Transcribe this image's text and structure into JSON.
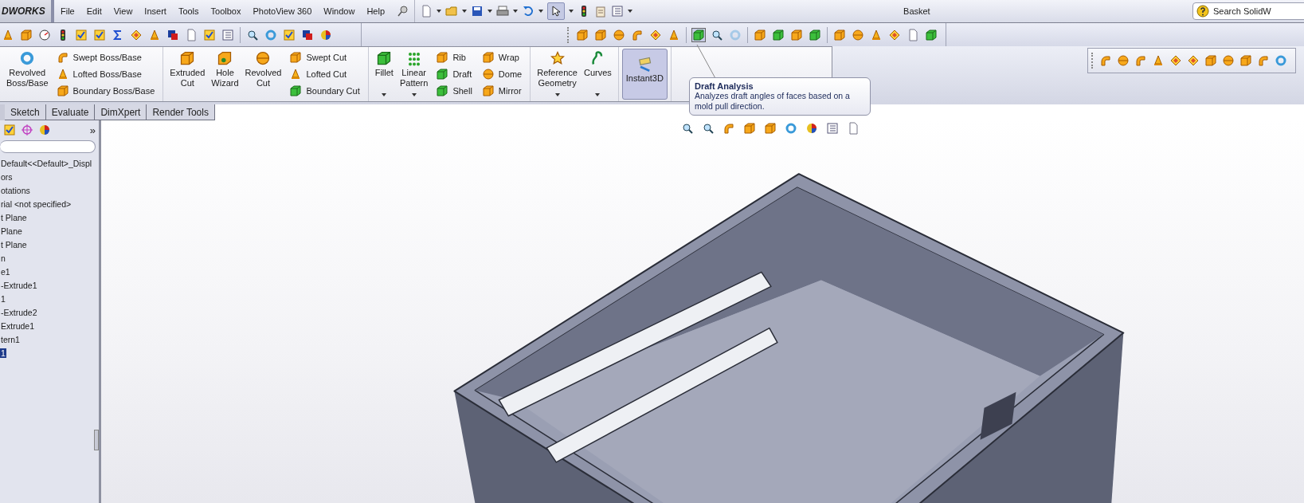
{
  "title_bar": {
    "logo": "DWORKS",
    "menu": [
      "File",
      "Edit",
      "View",
      "Insert",
      "Tools",
      "Toolbox",
      "PhotoView 360",
      "Window",
      "Help"
    ],
    "document_title": "Basket",
    "search": {
      "placeholder": "Search SolidW"
    }
  },
  "command_manager": {
    "groups": [
      {
        "items": [
          {
            "kind": "large",
            "label": "Revolved Boss/Base",
            "dropdown": false,
            "on": false
          },
          {
            "kind": "small",
            "label": "Swept Boss/Base"
          },
          {
            "kind": "small",
            "label": "Lofted Boss/Base"
          },
          {
            "kind": "small",
            "label": "Boundary Boss/Base"
          }
        ]
      },
      {
        "items": [
          {
            "kind": "large",
            "label": "Extruded Cut",
            "dropdown": false,
            "on": false
          },
          {
            "kind": "large",
            "label": "Hole Wizard",
            "dropdown": false,
            "on": false
          },
          {
            "kind": "large",
            "label": "Revolved Cut",
            "dropdown": false,
            "on": false
          },
          {
            "kind": "small",
            "label": "Swept Cut"
          },
          {
            "kind": "small",
            "label": "Lofted Cut"
          },
          {
            "kind": "small",
            "label": "Boundary Cut"
          }
        ]
      },
      {
        "items": [
          {
            "kind": "large",
            "label": "Fillet",
            "dropdown": true,
            "on": false
          },
          {
            "kind": "large",
            "label": "Linear Pattern",
            "dropdown": true,
            "on": false
          },
          {
            "kind": "small",
            "label": "Rib"
          },
          {
            "kind": "small",
            "label": "Draft"
          },
          {
            "kind": "small",
            "label": "Shell"
          },
          {
            "kind": "small",
            "label": "Wrap"
          },
          {
            "kind": "small",
            "label": "Dome"
          },
          {
            "kind": "small",
            "label": "Mirror"
          }
        ]
      },
      {
        "items": [
          {
            "kind": "large",
            "label": "Reference Geometry",
            "dropdown": true,
            "on": false
          },
          {
            "kind": "large",
            "label": "Curves",
            "dropdown": true,
            "on": false
          }
        ]
      },
      {
        "items": [
          {
            "kind": "large",
            "label": "Instant3D",
            "dropdown": false,
            "on": true
          }
        ]
      }
    ]
  },
  "tabs": [
    {
      "label": "Sketch"
    },
    {
      "label": "Evaluate"
    },
    {
      "label": "DimXpert"
    },
    {
      "label": "Render Tools"
    }
  ],
  "tooltip": {
    "title": "Draft Analysis",
    "text": "Analyzes draft angles of faces based on a mold pull direction."
  },
  "feature_tree": {
    "more": "»",
    "items": [
      {
        "label": "Default<<Default>_Displ",
        "selected": false
      },
      {
        "label": "ors",
        "selected": false
      },
      {
        "label": "otations",
        "selected": false
      },
      {
        "label": "rial <not specified>",
        "selected": false
      },
      {
        "label": "t Plane",
        "selected": false
      },
      {
        "label": "Plane",
        "selected": false
      },
      {
        "label": "t Plane",
        "selected": false
      },
      {
        "label": "n",
        "selected": false
      },
      {
        "label": "e1",
        "selected": false
      },
      {
        "label": "-Extrude1",
        "selected": false
      },
      {
        "label": "1",
        "selected": false
      },
      {
        "label": "-Extrude2",
        "selected": false
      },
      {
        "label": "Extrude1",
        "selected": false
      },
      {
        "label": "tern1",
        "selected": false
      },
      {
        "label": "1",
        "selected": true
      }
    ]
  }
}
